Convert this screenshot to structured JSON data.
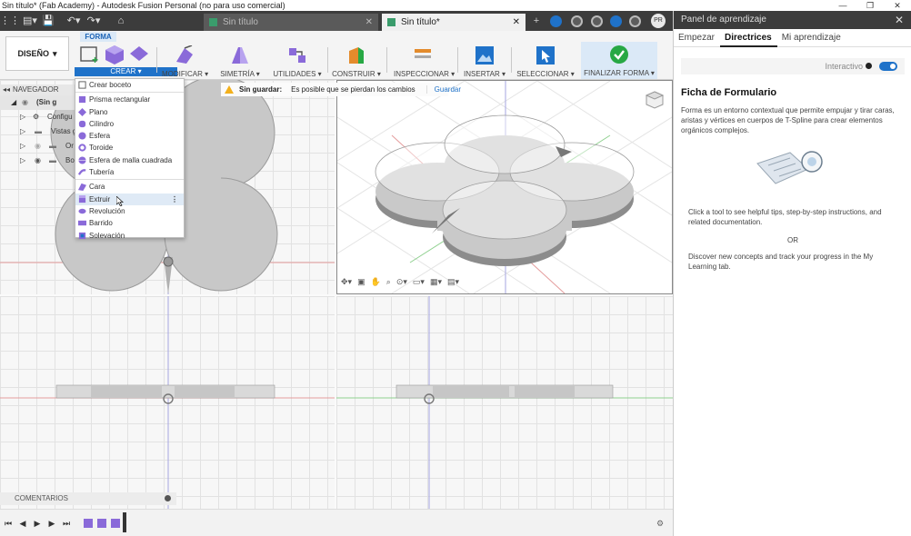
{
  "window": {
    "title": "Sin título* (Fab Academy) - Autodesk Fusion Personal (no para uso comercial)"
  },
  "tabs": [
    {
      "label": "Sin título"
    },
    {
      "label": "Sin título*"
    }
  ],
  "user": {
    "initials": "PR"
  },
  "toolbar": {
    "workspace": "DISEÑO",
    "active_tab": "FORMA",
    "groups": {
      "crear": "CREAR",
      "modificar": "MODIFICAR",
      "simetria": "SIMETRÍA",
      "utilidades": "UTILIDADES",
      "construir": "CONSTRUIR",
      "inspeccionar": "INSPECCIONAR",
      "insertar": "INSERTAR",
      "seleccionar": "SELECCIONAR",
      "finalizar": "FINALIZAR FORMA"
    }
  },
  "navigator": {
    "title": "NAVEGADOR",
    "items": [
      {
        "label": "(Sin g"
      },
      {
        "label": "Configu"
      },
      {
        "label": "Vistas g"
      },
      {
        "label": "Or"
      },
      {
        "label": "Bo"
      }
    ]
  },
  "warning": {
    "title": "Sin guardar:",
    "message": "Es posible que se pierdan los cambios",
    "action": "Guardar"
  },
  "crear_menu": {
    "items": [
      {
        "label": "Crear boceto",
        "icon": "sketch-icon"
      },
      {
        "label": "Prisma rectangular",
        "icon": "box-icon"
      },
      {
        "label": "Plano",
        "icon": "plane-icon"
      },
      {
        "label": "Cilindro",
        "icon": "cylinder-icon"
      },
      {
        "label": "Esfera",
        "icon": "sphere-icon"
      },
      {
        "label": "Toroide",
        "icon": "torus-icon"
      },
      {
        "label": "Esfera de malla cuadrada",
        "icon": "quadball-icon"
      },
      {
        "label": "Tubería",
        "icon": "pipe-icon"
      },
      {
        "label": "Cara",
        "icon": "face-icon"
      },
      {
        "label": "Extruir",
        "icon": "extrude-icon"
      },
      {
        "label": "Revolución",
        "icon": "revolve-icon"
      },
      {
        "label": "Barrido",
        "icon": "sweep-icon"
      },
      {
        "label": "Solevación",
        "icon": "loft-icon"
      }
    ]
  },
  "comments": {
    "label": "COMENTARIOS"
  },
  "learning_panel": {
    "title": "Panel de aprendizaje",
    "tabs": [
      "Empezar",
      "Directrices",
      "Mi aprendizaje"
    ],
    "active_tab": "Directrices",
    "interactive_label": "Interactivo",
    "heading": "Ficha de Formulario",
    "description": "Forma es un entorno contextual que permite empujar y tirar caras, aristas y vértices en cuerpos de T-Spline para crear elementos orgánicos complejos.",
    "tip1": "Click a tool to see helpful tips, step-by-step instructions, and related documentation.",
    "or": "OR",
    "tip2": "Discover new concepts and track your progress in the My Learning tab."
  },
  "colors": {
    "accent": "#1f72c9",
    "dark_bar": "#3c3c3c",
    "finalize_green": "#27a844",
    "tspline_purple": "#8a6ad9",
    "warning": "#f3b01c"
  }
}
